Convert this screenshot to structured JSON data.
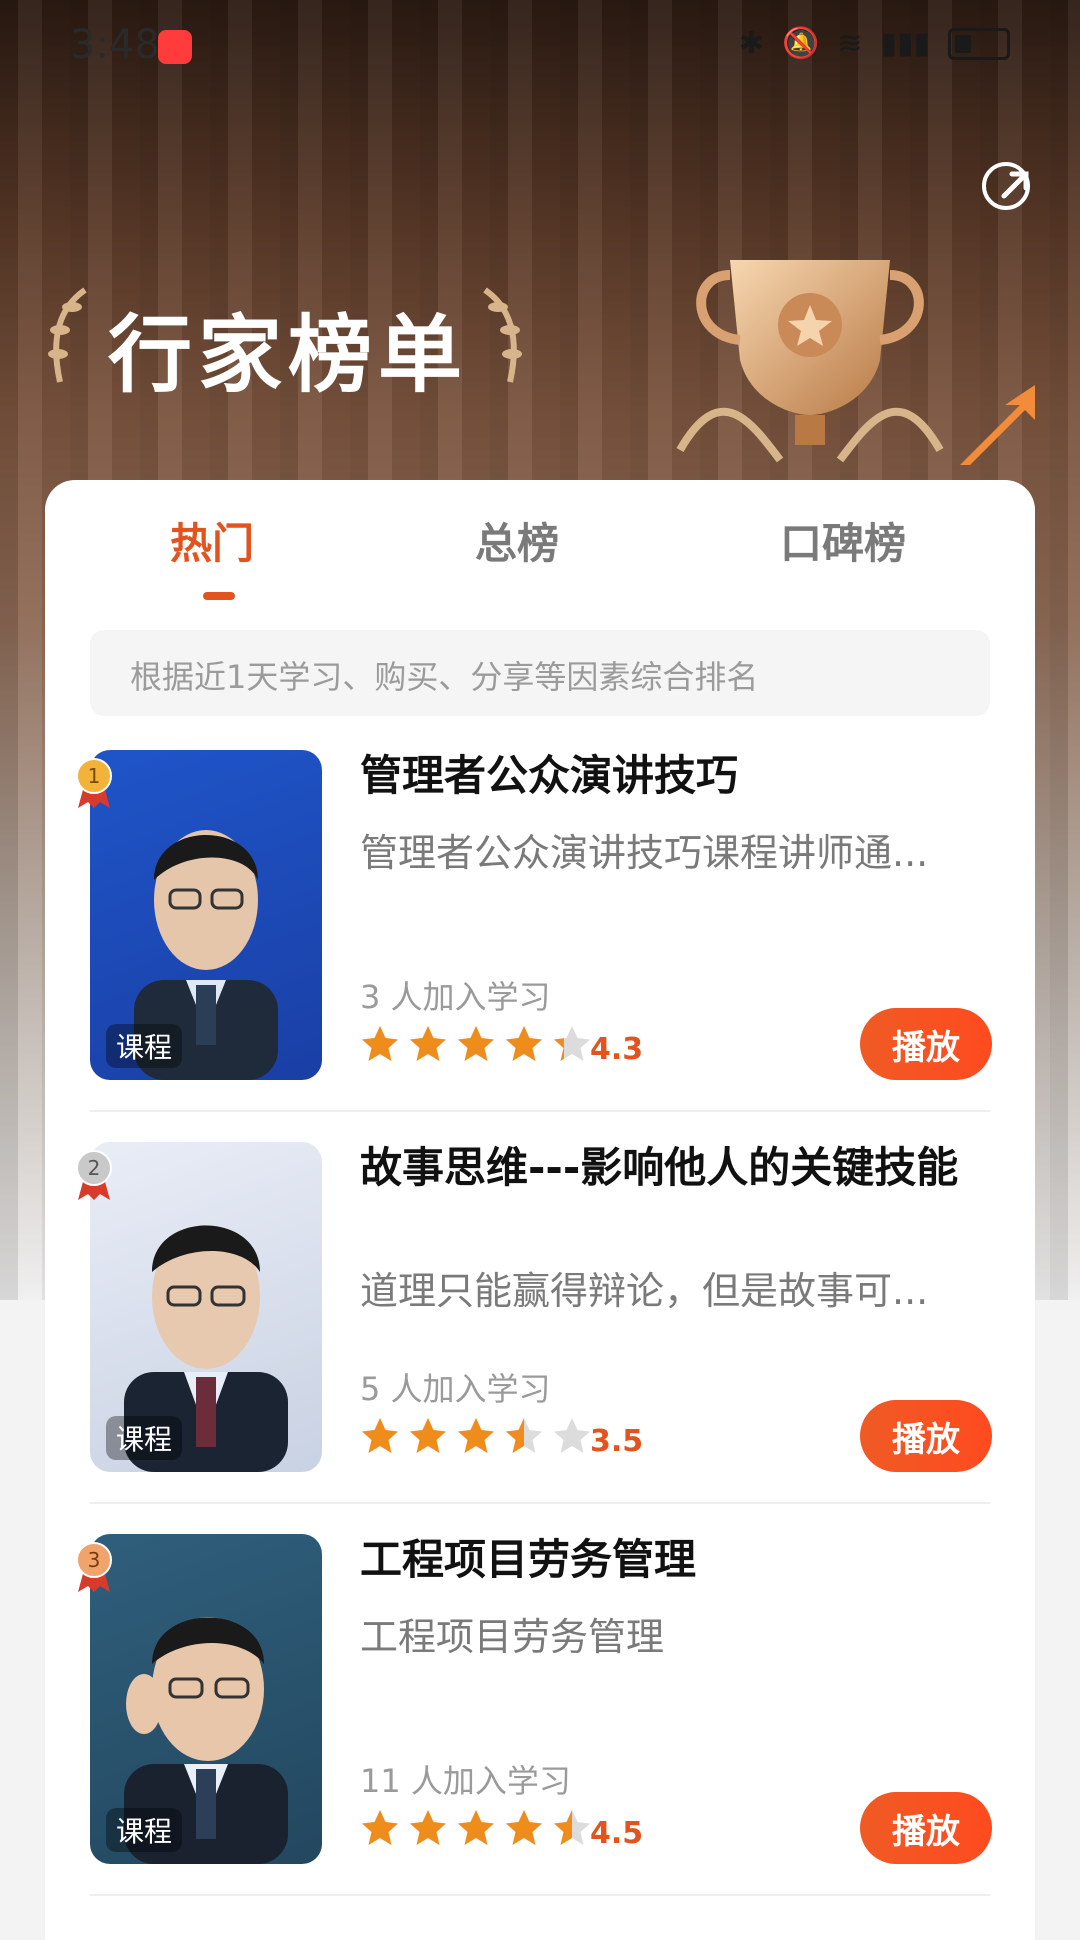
{
  "status_bar": {
    "time": "3:48",
    "icons": [
      "bluetooth-icon",
      "mute-icon",
      "wifi-icon",
      "signal-icon",
      "battery-icon"
    ]
  },
  "header": {
    "title": "行家榜单",
    "share_icon": "share-icon"
  },
  "tabs": [
    {
      "label": "热门",
      "active": true
    },
    {
      "label": "总榜",
      "active": false
    },
    {
      "label": "口碑榜",
      "active": false
    }
  ],
  "info_text": "根据近1天学习、购买、分享等因素综合排名",
  "items": [
    {
      "rank": "1",
      "thumb_tag": "课程",
      "title": "管理者公众演讲技巧",
      "description": "管理者公众演讲技巧课程讲师通...",
      "learners": "3 人加入学习",
      "rating": 4.3,
      "score": "4.3",
      "play_label": "播放"
    },
    {
      "rank": "2",
      "thumb_tag": "课程",
      "title": "故事思维---影响他人的关键技能",
      "description": "道理只能赢得辩论，但是故事可...",
      "learners": "5 人加入学习",
      "rating": 3.5,
      "score": "3.5",
      "play_label": "播放"
    },
    {
      "rank": "3",
      "thumb_tag": "课程",
      "title": "工程项目劳务管理",
      "description": "工程项目劳务管理",
      "learners": "11 人加入学习",
      "rating": 4.5,
      "score": "4.5",
      "play_label": "播放"
    }
  ],
  "colors": {
    "accent": "#e2531d",
    "star": "#f08c1c"
  }
}
